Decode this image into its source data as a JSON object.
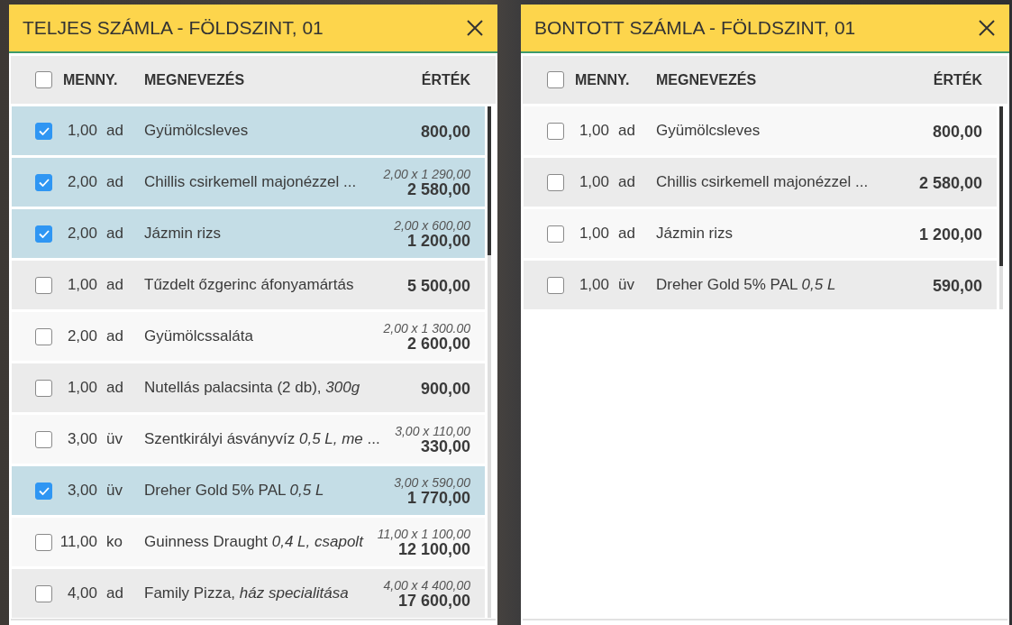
{
  "panels": [
    {
      "title": "TELJES SZÁMLA - FÖLDSZINT, 01",
      "header": {
        "checked": false,
        "columns": [
          "MENNY.",
          "MEGNEVEZÉS",
          "ÉRTÉK"
        ]
      },
      "rows": [
        {
          "checked": true,
          "quantity": "1,00",
          "unit": "ad",
          "name": "Gyümölcsleves",
          "value": "800,00"
        },
        {
          "checked": true,
          "quantity": "2,00",
          "unit": "ad",
          "name": "Chillis csirkemell majonézzel ...",
          "unit_price": "2,00 x 1 290,00",
          "value": "2 580,00"
        },
        {
          "checked": true,
          "quantity": "2,00",
          "unit": "ad",
          "name": "Jázmin rizs",
          "unit_price": "2,00 x 600,00",
          "value": "1 200,00"
        },
        {
          "checked": false,
          "quantity": "1,00",
          "unit": "ad",
          "name": "Tűzdelt őzgerinc áfonyamártás",
          "value": "5 500,00"
        },
        {
          "checked": false,
          "quantity": "2,00",
          "unit": "ad",
          "name": "Gyümölcssaláta",
          "unit_price": "2,00 x 1 300.00",
          "value": "2 600,00"
        },
        {
          "checked": false,
          "quantity": "1,00",
          "unit": "ad",
          "name": "Nutellás palacsinta (2 db), *300g*",
          "value": "900,00"
        },
        {
          "checked": false,
          "quantity": "3,00",
          "unit": "üv",
          "name": "Szentkirályi ásványvíz *0,5 L, me* ...",
          "unit_price": "3,00 x 110,00",
          "value": "330,00"
        },
        {
          "checked": true,
          "quantity": "3,00",
          "unit": "üv",
          "name": "Dreher Gold 5% PAL *0,5 L*",
          "unit_price": "3,00 x 590,00",
          "value": "1 770,00"
        },
        {
          "checked": false,
          "quantity": "11,00",
          "unit": "ko",
          "name": "Guinness Draught *0,4 L, csapolt*",
          "unit_price": "11,00 x 1 100,00",
          "value": "12 100,00"
        },
        {
          "checked": false,
          "quantity": "4,00",
          "unit": "ad",
          "name": "Family Pizza, *ház specialitása*",
          "unit_price": "4,00 x 4 400,00",
          "value": "17 600,00"
        }
      ]
    },
    {
      "title": "BONTOTT SZÁMLA - FÖLDSZINT, 01",
      "header": {
        "checked": false,
        "columns": [
          "MENNY.",
          "MEGNEVEZÉS",
          "ÉRTÉK"
        ]
      },
      "rows": [
        {
          "checked": false,
          "quantity": "1,00",
          "unit": "ad",
          "name": "Gyümölcsleves",
          "value": "800,00"
        },
        {
          "checked": false,
          "quantity": "1,00",
          "unit": "ad",
          "name": "Chillis csirkemell majonézzel ...",
          "value": "2 580,00"
        },
        {
          "checked": false,
          "quantity": "1,00",
          "unit": "ad",
          "name": "Jázmin rizs",
          "value": "1 200,00"
        },
        {
          "checked": false,
          "quantity": "1,00",
          "unit": "üv",
          "name": "Dreher Gold 5% PAL *0,5 L*",
          "value": "590,00"
        }
      ]
    }
  ]
}
